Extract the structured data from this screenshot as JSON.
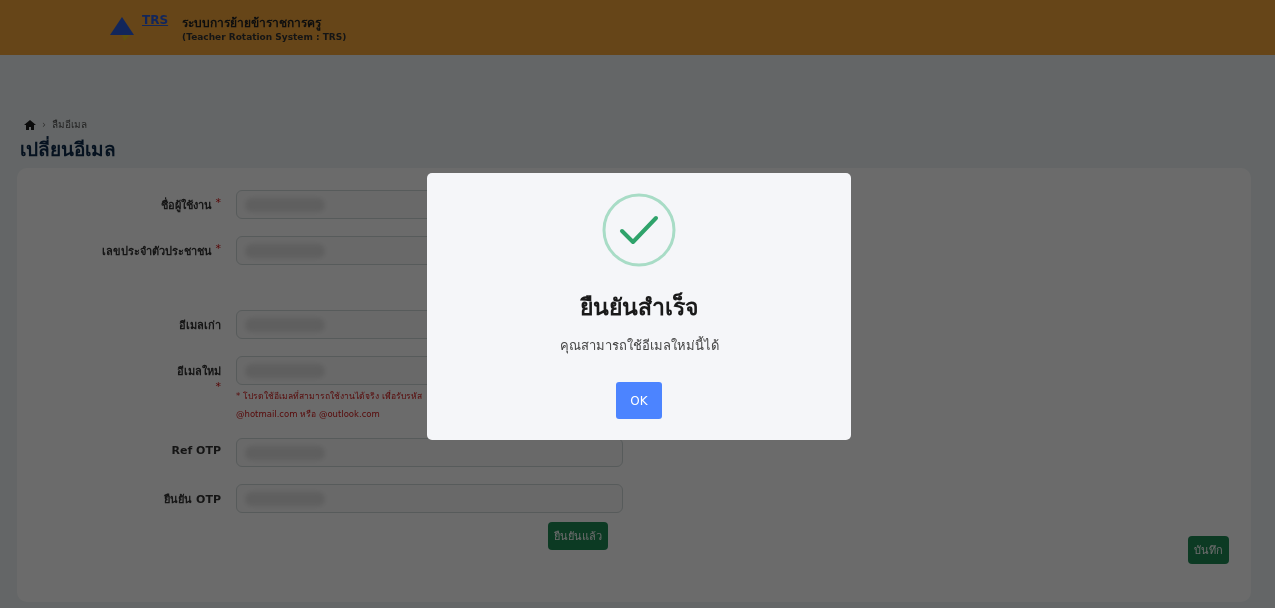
{
  "header": {
    "logo_text": "TRS",
    "title": "ระบบการย้ายข้าราชการครู",
    "subtitle": "(Teacher Rotation System : TRS)"
  },
  "breadcrumb": {
    "separator": "›",
    "current": "ลืมอีเมล"
  },
  "page_title": "เปลี่ยนอีเมล",
  "form": {
    "sections": [
      [
        {
          "label": "ชื่อผู้ใช้งาน",
          "mark": "*"
        },
        {
          "label": "เลขประจำตัวประชาชน",
          "mark": "*"
        }
      ],
      [
        {
          "label": "อีเมลเก่า"
        },
        {
          "label": "อีเมลใหม่",
          "mark": "*",
          "hint": [
            "* โปรดใช้อีเมลที่สามารถใช้งานได้จริง เพื่อรับรหัส",
            "@hotmail.com หรือ @outlook.com"
          ]
        },
        {
          "label": "Ref OTP"
        },
        {
          "label": "ยืนยัน OTP"
        }
      ]
    ],
    "confirm_button": "ยืนยันแล้ว",
    "save_button": "บันทึก"
  },
  "dialog": {
    "title": "ยืนยันสำเร็จ",
    "message": "คุณสามารถใช้อีเมลใหม่นี้ได้",
    "ok_button": "OK"
  }
}
